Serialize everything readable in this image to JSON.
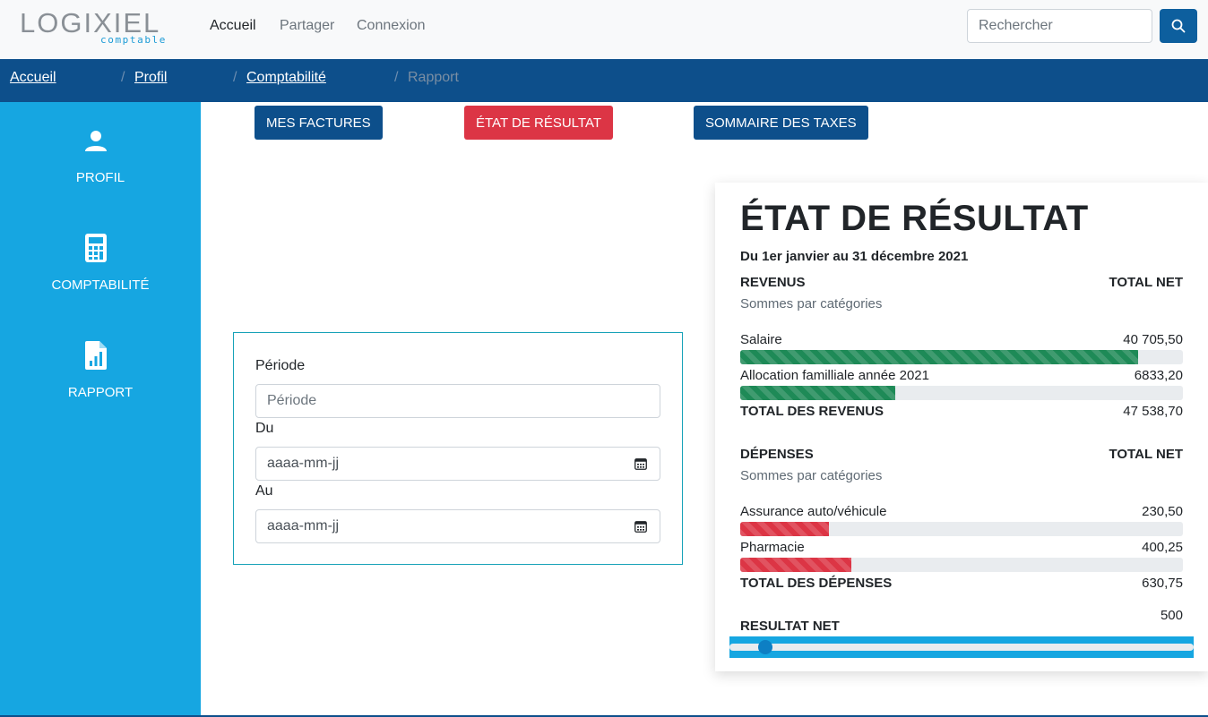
{
  "app": {
    "logo_word": "LOGIXIEL",
    "logo_sub": "comptable"
  },
  "nav": {
    "items": [
      {
        "label": "Accueil",
        "active": true
      },
      {
        "label": "Partager"
      },
      {
        "label": "Connexion"
      }
    ]
  },
  "search": {
    "placeholder": "Rechercher"
  },
  "breadcrumb": {
    "items": [
      {
        "label": "Accueil"
      },
      {
        "label": "Profil"
      },
      {
        "label": "Comptabilité"
      },
      {
        "label": "Rapport"
      }
    ],
    "separator": "/"
  },
  "sidebar": {
    "items": [
      {
        "label": "PROFIL",
        "icon": "user-icon"
      },
      {
        "label": "COMPTABILITÉ",
        "icon": "calculator-icon"
      },
      {
        "label": "RAPPORT",
        "icon": "report-chart-icon"
      }
    ]
  },
  "tabs": [
    {
      "label": "MES FACTURES"
    },
    {
      "label": "ÉTAT DE RÉSULTAT",
      "active": true
    },
    {
      "label": "SOMMAIRE DES TAXES"
    }
  ],
  "form": {
    "periode_label": "Période",
    "periode_placeholder": "Période",
    "du_label": "Du",
    "du_placeholder": "aaaa-mm-jj",
    "au_label": "Au",
    "au_placeholder": "aaaa-mm-jj"
  },
  "report": {
    "title": "ÉTAT DE RÉSULTAT",
    "period": "Du 1er janvier au 31 décembre 2021",
    "revenus": {
      "heading": "REVENUS",
      "column": "TOTAL NET",
      "subtitle": "Sommes par catégories",
      "items": [
        {
          "label": "Salaire",
          "amount": "40 705,50",
          "fraction": 0.898
        },
        {
          "label": "Allocation familliale année 2021",
          "amount": "6833,20",
          "fraction": 0.35
        }
      ],
      "total_label": "TOTAL DES REVENUS",
      "total_amount": "47 538,70"
    },
    "depenses": {
      "heading": "DÉPENSES",
      "column": "TOTAL NET",
      "subtitle": "Sommes par catégories",
      "items": [
        {
          "label": "Assurance auto/véhicule",
          "amount": "230,50",
          "fraction": 0.2
        },
        {
          "label": "Pharmacie",
          "amount": "400,25",
          "fraction": 0.25
        }
      ],
      "total_label": "TOTAL DES DÉPENSES",
      "total_amount": "630,75"
    },
    "resultat": {
      "label": "RESULTAT NET",
      "value": "500",
      "slider_fraction": 0.06
    }
  },
  "colors": {
    "brand_blue": "#0d4f8b",
    "sidebar_blue": "#16a6e1",
    "danger": "#dc3545",
    "success": "#1e8a57"
  }
}
